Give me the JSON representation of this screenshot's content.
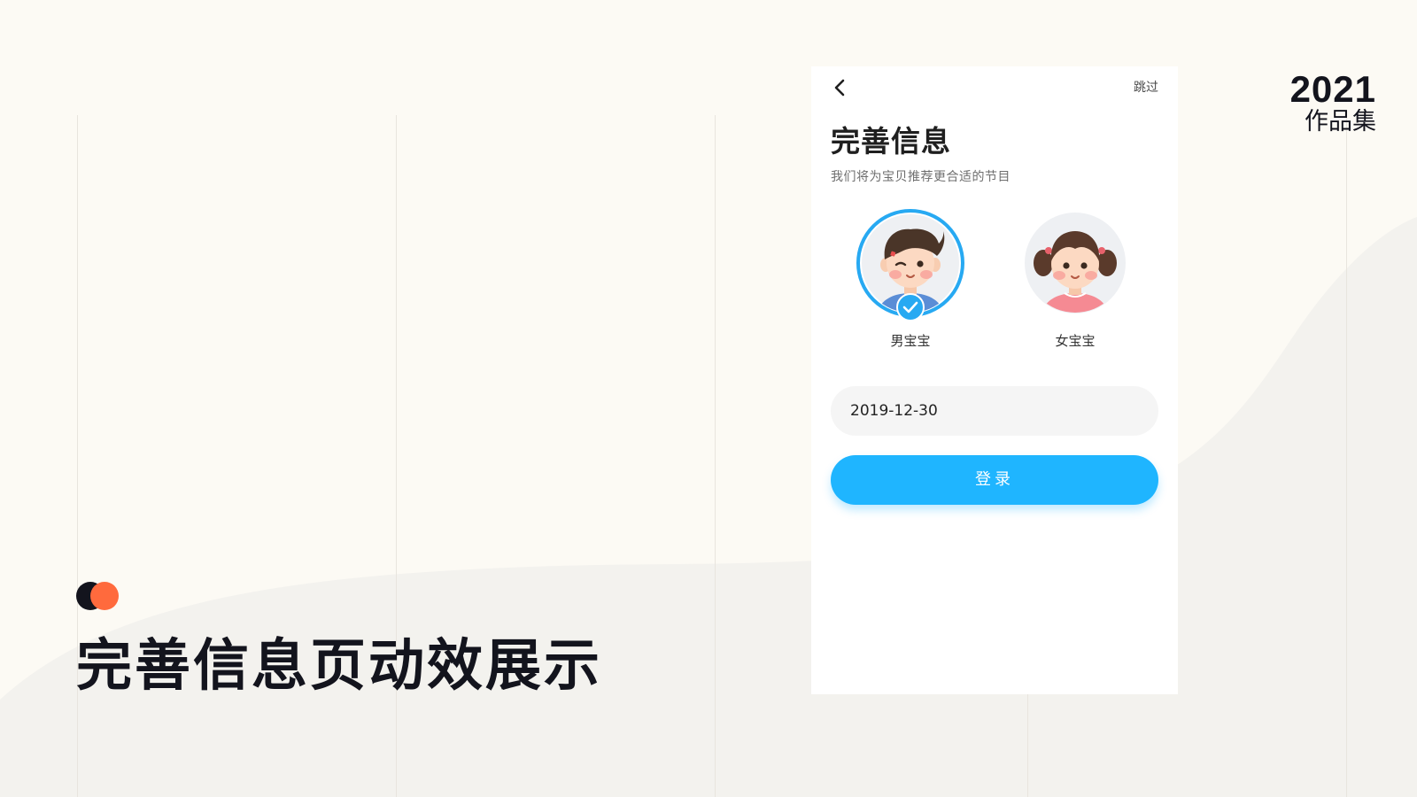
{
  "showcase": {
    "year": "2021",
    "portfolio_label": "作品集",
    "title": "完善信息页动效展示"
  },
  "phone": {
    "skip_label": "跳过",
    "page_title": "完善信息",
    "page_subtitle": "我们将为宝贝推荐更合适的节目",
    "genders": [
      {
        "label": "男宝宝",
        "selected": true,
        "icon": "boy-avatar-icon"
      },
      {
        "label": "女宝宝",
        "selected": false,
        "icon": "girl-avatar-icon"
      }
    ],
    "birthday_value": "2019-12-30",
    "login_label": "登录"
  },
  "colors": {
    "background": "#fcfaf4",
    "wave": "#f3f2ee",
    "accent_blue": "#1fb5ff",
    "selected_ring": "#27a9f2",
    "dot_dark": "#13141d",
    "dot_orange": "#ff6a3d",
    "title_dark": "#13141d"
  }
}
